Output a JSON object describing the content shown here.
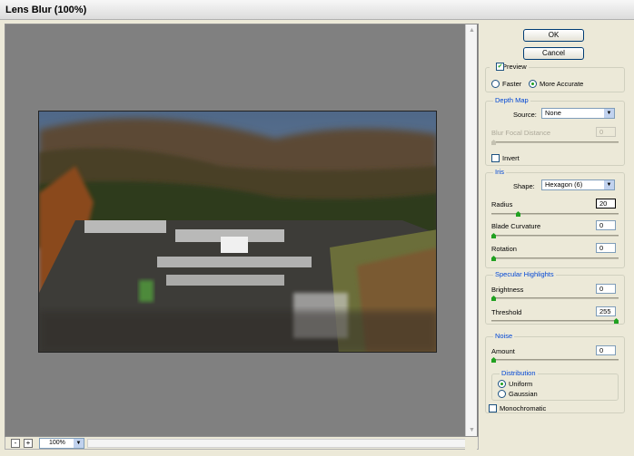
{
  "window": {
    "title": "Lens Blur (100%)"
  },
  "preview": {
    "zoom": "100%",
    "minus_label": "-",
    "plus_label": "+"
  },
  "buttons": {
    "ok": "OK",
    "cancel": "Cancel"
  },
  "preview_opts": {
    "preview_label": "Preview",
    "preview_checked": true,
    "faster_label": "Faster",
    "accurate_label": "More Accurate",
    "selected": "More Accurate"
  },
  "depth_map": {
    "title": "Depth Map",
    "source_label": "Source:",
    "source_value": "None",
    "focal_label": "Blur Focal Distance",
    "focal_value": "0",
    "invert_label": "Invert"
  },
  "iris": {
    "title": "Iris",
    "shape_label": "Shape:",
    "shape_value": "Hexagon (6)",
    "radius_label": "Radius",
    "radius_value": "20",
    "curvature_label": "Blade Curvature",
    "curvature_value": "0",
    "rotation_label": "Rotation",
    "rotation_value": "0"
  },
  "specular": {
    "title": "Specular Highlights",
    "brightness_label": "Brightness",
    "brightness_value": "0",
    "threshold_label": "Threshold",
    "threshold_value": "255"
  },
  "noise": {
    "title": "Noise",
    "amount_label": "Amount",
    "amount_value": "0",
    "distribution_title": "Distribution",
    "uniform_label": "Uniform",
    "gaussian_label": "Gaussian",
    "selected": "Uniform",
    "mono_label": "Monochromatic"
  },
  "sliders": {
    "focal": 0,
    "radius": 0.2,
    "curvature": 0,
    "rotation": 0,
    "brightness": 0,
    "threshold": 1,
    "amount": 0
  },
  "colors": {
    "accent": "#0046d5",
    "check": "#21a121",
    "canvas_bg": "#808080"
  }
}
